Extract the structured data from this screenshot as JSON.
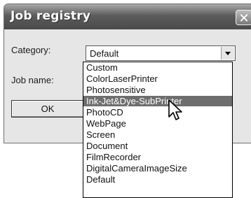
{
  "dialog": {
    "title": "Job registry",
    "close_label": "✕",
    "category_label": "Category:",
    "job_name_label": "Job name:",
    "category_value": "Default",
    "ok_label": "OK"
  },
  "dropdown": {
    "items": [
      {
        "label": "Custom",
        "selected": false
      },
      {
        "label": "ColorLaserPrinter",
        "selected": false
      },
      {
        "label": "Photosensitive",
        "selected": false
      },
      {
        "label": "Ink-Jet&Dye-SubPrinter",
        "selected": true
      },
      {
        "label": "PhotoCD",
        "selected": false
      },
      {
        "label": "WebPage",
        "selected": false
      },
      {
        "label": "Screen",
        "selected": false
      },
      {
        "label": "Document",
        "selected": false
      },
      {
        "label": "FilmRecorder",
        "selected": false
      },
      {
        "label": "DigitalCameraImageSize",
        "selected": false
      },
      {
        "label": "Default",
        "selected": false
      }
    ]
  },
  "colors": {
    "selection": "#6e6e6e",
    "titlebar": "#4a4a4a"
  },
  "icons": {
    "cursor": "mouse-pointer-icon",
    "close": "close-icon",
    "dropdown_arrow": "chevron-down-icon"
  }
}
